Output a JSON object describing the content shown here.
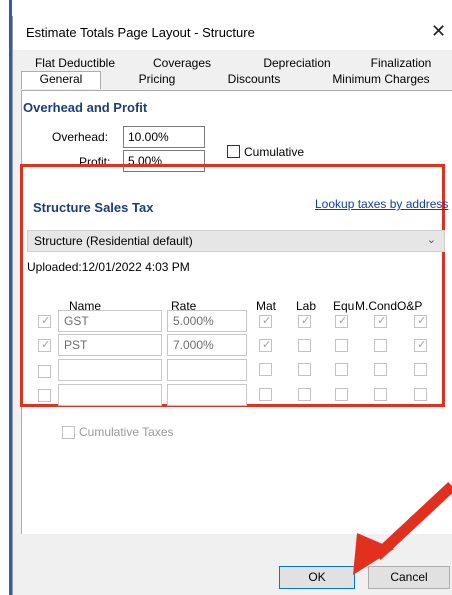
{
  "window": {
    "title": "Estimate Totals Page Layout - Structure",
    "close_glyph": "✕"
  },
  "tabs": {
    "top": [
      "Flat Deductible",
      "Coverages",
      "Depreciation",
      "Finalization"
    ],
    "bottom": [
      "General",
      "Pricing",
      "Discounts",
      "Minimum Charges"
    ],
    "active": "General"
  },
  "overhead_profit": {
    "heading": "Overhead and Profit",
    "overhead_label": "Overhead:",
    "overhead_value": "10.00%",
    "profit_label": "Profit:",
    "profit_value": "5.00%",
    "cumulative_label": "Cumulative",
    "cumulative_checked": false
  },
  "sales_tax": {
    "heading": "Structure Sales Tax",
    "lookup_link": "Lookup taxes by address",
    "region": "Structure (Residential default)",
    "uploaded": "Uploaded:12/01/2022 4:03 PM",
    "columns": {
      "name": "Name",
      "rate": "Rate",
      "mat": "Mat",
      "lab": "Lab",
      "equ": "Equ",
      "mcond": "M.Cond",
      "op": "O&P"
    },
    "rows": [
      {
        "name": "GST",
        "rate": "5.000%"
      },
      {
        "name": "PST",
        "rate": "7.000%"
      },
      {
        "name": "",
        "rate": ""
      },
      {
        "name": "",
        "rate": ""
      }
    ],
    "cumulative_taxes_label": "Cumulative Taxes"
  },
  "footer": {
    "ok_label": "OK",
    "cancel_label": "Cancel"
  },
  "colors": {
    "highlight": "#e1301e",
    "heading": "#1b3f7d",
    "link": "#0b3ea8"
  }
}
